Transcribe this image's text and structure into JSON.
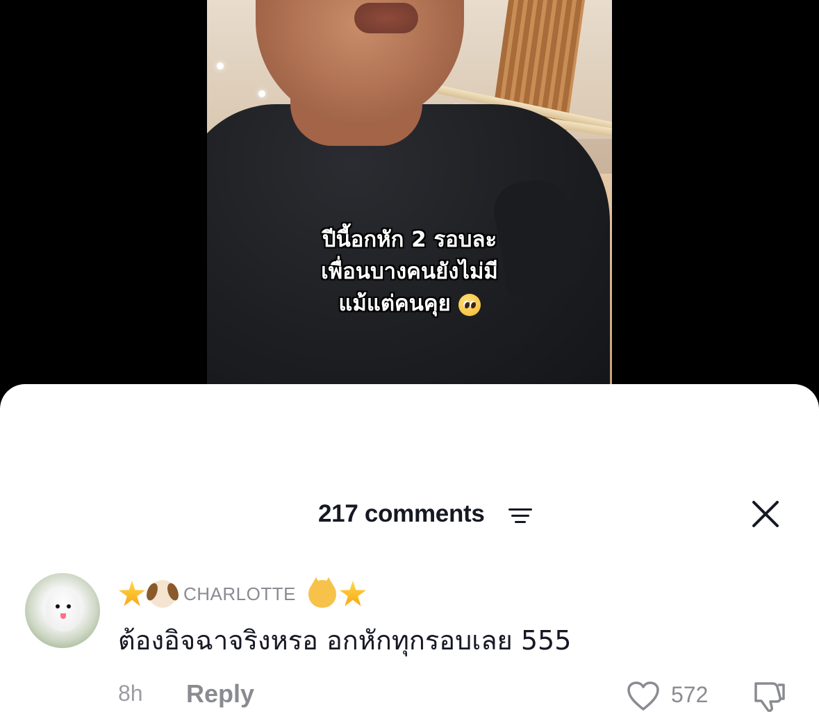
{
  "video": {
    "caption_lines": [
      "ปีนี้อกหัก 2 รอบละ",
      "เพื่อนบางคนยังไม่มี",
      "แม้แต่คนคุย"
    ],
    "caption_emoji": "pleading-face-emoji"
  },
  "comments_panel": {
    "count_label": "217 comments",
    "sort_icon": "sort-filter-icon",
    "close_icon": "close-icon"
  },
  "comment": {
    "avatar": "white-pomeranian-avatar",
    "username": "CHARLOTTE",
    "username_emojis_left": [
      "star",
      "dog-face"
    ],
    "username_emojis_right": [
      "cat-face",
      "star"
    ],
    "text": "ต้องอิจฉาจริงหรอ อกหักทุกรอบเลย 555",
    "time": "8h",
    "reply_label": "Reply",
    "like_count": "572",
    "like_icon": "heart-outline-icon",
    "dislike_icon": "thumbs-down-icon"
  }
}
